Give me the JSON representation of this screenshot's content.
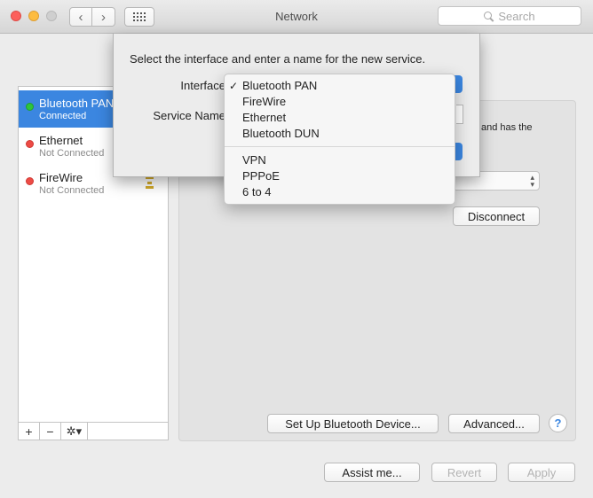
{
  "window": {
    "title": "Network",
    "search_placeholder": "Search",
    "back_glyph": "‹",
    "forward_glyph": "›"
  },
  "services": [
    {
      "name": "Bluetooth PAN",
      "status": "Connected",
      "color": "green",
      "selected": true
    },
    {
      "name": "Ethernet",
      "status": "Not Connected",
      "color": "red",
      "selected": false
    },
    {
      "name": "FireWire",
      "status": "Not Connected",
      "color": "red",
      "selected": false
    }
  ],
  "sidebar_toolbar": {
    "add": "+",
    "remove": "−",
    "gear": "✲▾"
  },
  "detail": {
    "partial_text": "and has the",
    "disconnect_button": "Disconnect",
    "setup_bluetooth_button": "Set Up Bluetooth Device...",
    "advanced_button": "Advanced...",
    "help_button": "?"
  },
  "footer": {
    "assist_button": "Assist me...",
    "revert_button": "Revert",
    "apply_button": "Apply"
  },
  "sheet": {
    "prompt": "Select the interface and enter a name for the new service.",
    "interface_label": "Interface",
    "service_name_label": "Service Name"
  },
  "interface_menu": {
    "selected": "Bluetooth PAN",
    "check_glyph": "✓",
    "group1": [
      "Bluetooth PAN",
      "FireWire",
      "Ethernet",
      "Bluetooth DUN"
    ],
    "group2": [
      "VPN",
      "PPPoE",
      "6 to 4"
    ]
  },
  "colors": {
    "accent": "#3b86e0",
    "status_green": "#2ec53c",
    "status_red": "#ed4b45",
    "lock_gold": "#d2aa2a"
  }
}
